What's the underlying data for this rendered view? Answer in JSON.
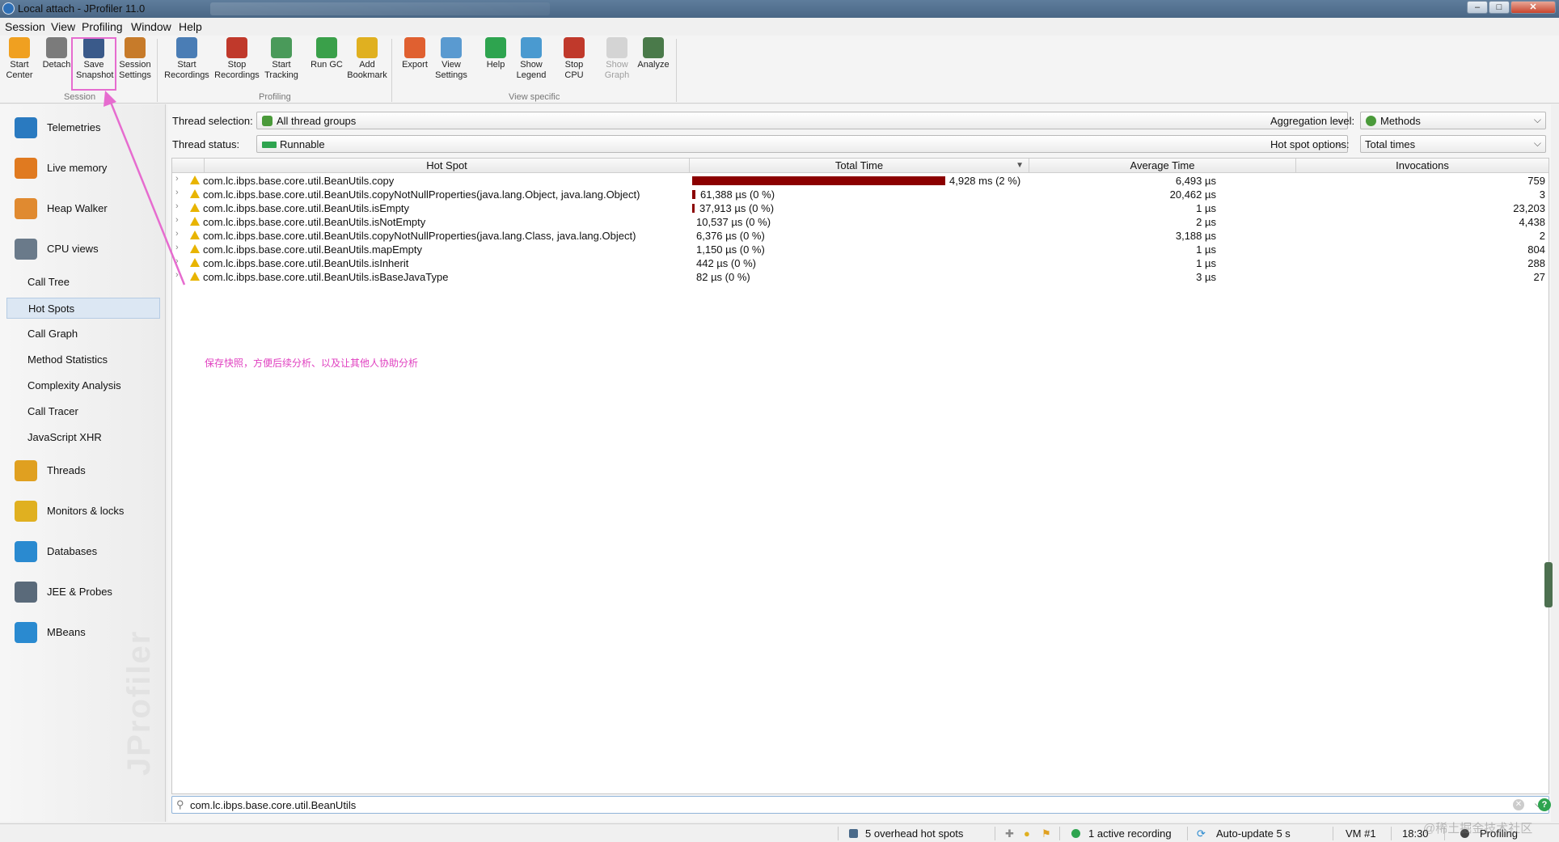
{
  "window": {
    "title": "Local attach - JProfiler 11.0",
    "controls": [
      "–",
      "□",
      "✕"
    ]
  },
  "menu": [
    "Session",
    "View",
    "Profiling",
    "Window",
    "Help"
  ],
  "toolbar": {
    "session": [
      {
        "label1": "Start",
        "label2": "Center",
        "icon": "start-center-icon",
        "color": "#f0a020"
      },
      {
        "label1": "Detach",
        "label2": "",
        "icon": "detach-icon",
        "color": "#7b7b7b"
      },
      {
        "label1": "Save",
        "label2": "Snapshot",
        "icon": "save-icon",
        "color": "#3a5a8a"
      },
      {
        "label1": "Session",
        "label2": "Settings",
        "icon": "settings-icon",
        "color": "#c77b2a"
      }
    ],
    "profiling": [
      {
        "label1": "Start",
        "label2": "Recordings",
        "icon": "start-recordings-icon",
        "color": "#4a7db5"
      },
      {
        "label1": "Stop",
        "label2": "Recordings",
        "icon": "stop-recordings-icon",
        "color": "#c0392b"
      },
      {
        "label1": "Start",
        "label2": "Tracking",
        "icon": "start-tracking-icon",
        "color": "#4a9a5a"
      },
      {
        "label1": "Run GC",
        "label2": "",
        "icon": "run-gc-icon",
        "color": "#3aa04a"
      },
      {
        "label1": "Add",
        "label2": "Bookmark",
        "icon": "bookmark-icon",
        "color": "#e0b020"
      }
    ],
    "view_specific": [
      {
        "label1": "Export",
        "label2": "",
        "icon": "export-icon",
        "color": "#e06030"
      },
      {
        "label1": "View",
        "label2": "Settings",
        "icon": "view-settings-icon",
        "color": "#5a9ad0"
      },
      {
        "label1": "Help",
        "label2": "",
        "icon": "help-icon",
        "color": "#2ea44f"
      },
      {
        "label1": "Show",
        "label2": "Legend",
        "icon": "legend-icon",
        "color": "#4a9ad0"
      },
      {
        "label1": "Stop",
        "label2": "CPU",
        "icon": "stop-cpu-icon",
        "color": "#c0392b"
      },
      {
        "label1": "Show",
        "label2": "Graph",
        "icon": "graph-icon",
        "color": "#999999",
        "disabled": true
      },
      {
        "label1": "Analyze",
        "label2": "",
        "icon": "analyze-icon",
        "color": "#4a7a4a"
      }
    ],
    "group_labels": {
      "session": "Session",
      "profiling": "Profiling",
      "view_specific": "View specific"
    }
  },
  "sidebar": {
    "sections": [
      {
        "label": "Telemetries",
        "icon": "telemetries-icon",
        "color": "#2a7ac0"
      },
      {
        "label": "Live memory",
        "icon": "live-memory-icon",
        "color": "#e07a20"
      },
      {
        "label": "Heap Walker",
        "icon": "heap-walker-icon",
        "color": "#e08a30"
      },
      {
        "label": "CPU views",
        "icon": "cpu-views-icon",
        "color": "#6a7a8a"
      }
    ],
    "cpu_subitems": [
      "Call Tree",
      "Hot Spots",
      "Call Graph",
      "Method Statistics",
      "Complexity Analysis",
      "Call Tracer",
      "JavaScript XHR"
    ],
    "selected_subitem": "Hot Spots",
    "sections2": [
      {
        "label": "Threads",
        "icon": "threads-icon",
        "color": "#e0a020"
      },
      {
        "label": "Monitors & locks",
        "icon": "lock-icon",
        "color": "#e0b020"
      },
      {
        "label": "Databases",
        "icon": "database-icon",
        "color": "#2a8ad0"
      },
      {
        "label": "JEE & Probes",
        "icon": "probes-icon",
        "color": "#5a6a7a"
      },
      {
        "label": "MBeans",
        "icon": "mbeans-icon",
        "color": "#2a8ad0"
      }
    ],
    "watermark": "JProfiler"
  },
  "filters": {
    "thread_selection_label": "Thread selection:",
    "thread_selection_value": "All thread groups",
    "thread_status_label": "Thread status:",
    "thread_status_value": "Runnable",
    "aggregation_label": "Aggregation level:",
    "aggregation_value": "Methods",
    "hotspot_options_label": "Hot spot options:",
    "hotspot_options_value": "Total times"
  },
  "table": {
    "columns": [
      "Hot Spot",
      "Total Time",
      "Average Time",
      "Invocations"
    ],
    "sort_indicator": "▼",
    "rows": [
      {
        "name": "com.lc.ibps.base.core.util.BeanUtils.copy",
        "total": "4,928 ms (2 %)",
        "bar_fraction": 1.0,
        "avg": "6,493 µs",
        "inv": "759"
      },
      {
        "name": "com.lc.ibps.base.core.util.BeanUtils.copyNotNullProperties(java.lang.Object, java.lang.Object)",
        "total": "61,388 µs (0 %)",
        "bar_fraction": 0.012,
        "avg": "20,462 µs",
        "inv": "3"
      },
      {
        "name": "com.lc.ibps.base.core.util.BeanUtils.isEmpty",
        "total": "37,913 µs (0 %)",
        "bar_fraction": 0.008,
        "avg": "1 µs",
        "inv": "23,203"
      },
      {
        "name": "com.lc.ibps.base.core.util.BeanUtils.isNotEmpty",
        "total": "10,537 µs (0 %)",
        "bar_fraction": 0,
        "avg": "2 µs",
        "inv": "4,438"
      },
      {
        "name": "com.lc.ibps.base.core.util.BeanUtils.copyNotNullProperties(java.lang.Class, java.lang.Object)",
        "total": "6,376 µs (0 %)",
        "bar_fraction": 0,
        "avg": "3,188 µs",
        "inv": "2"
      },
      {
        "name": "com.lc.ibps.base.core.util.BeanUtils.mapEmpty",
        "total": "1,150 µs (0 %)",
        "bar_fraction": 0,
        "avg": "1 µs",
        "inv": "804"
      },
      {
        "name": "com.lc.ibps.base.core.util.BeanUtils.isInherit",
        "total": "442 µs (0 %)",
        "bar_fraction": 0,
        "avg": "1 µs",
        "inv": "288"
      },
      {
        "name": "com.lc.ibps.base.core.util.BeanUtils.isBaseJavaType",
        "total": "82 µs (0 %)",
        "bar_fraction": 0,
        "avg": "3 µs",
        "inv": "27"
      }
    ]
  },
  "annotation": "保存快照，方便后续分析、以及让其他人协助分析",
  "search": {
    "value": "com.lc.ibps.base.core.util.BeanUtils"
  },
  "statusbar": {
    "overhead": "5 overhead hot spots",
    "recording": "1 active recording",
    "autoupdate": "Auto-update 5 s",
    "vm": "VM #1",
    "time": "18:30",
    "mode": "Profiling"
  },
  "watermark_corner": "@稀土掘金技术社区",
  "colors": {
    "bar": "#8b0000",
    "annotation": "#e040c0",
    "highlight": "#e66ccf"
  }
}
